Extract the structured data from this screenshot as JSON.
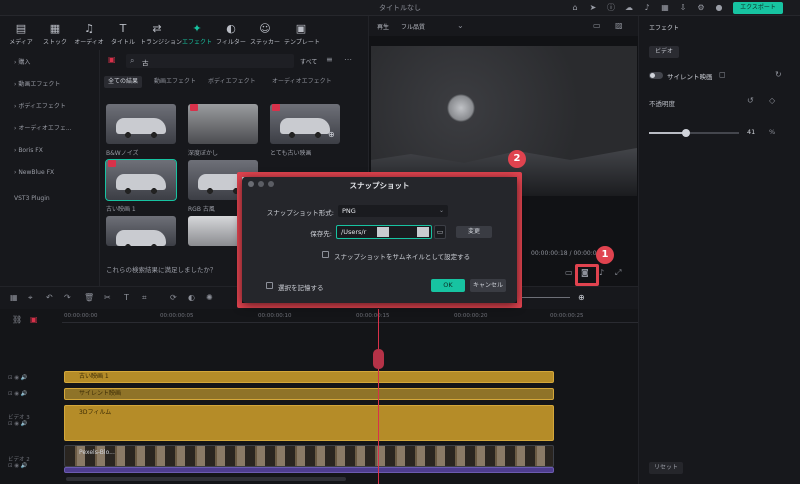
{
  "window": {
    "title": "タイトルなし",
    "export_label": "エクスポート"
  },
  "media_toolbar": {
    "tools": [
      {
        "label": "メディア",
        "icon": "▤"
      },
      {
        "label": "ストック",
        "icon": "▦"
      },
      {
        "label": "オーディオ",
        "icon": "♫"
      },
      {
        "label": "タイトル",
        "icon": "T"
      },
      {
        "label": "トランジション",
        "icon": "⇄"
      },
      {
        "label": "エフェクト",
        "icon": "✦"
      },
      {
        "label": "フィルター",
        "icon": "◐"
      },
      {
        "label": "ステッカー",
        "icon": "☺"
      },
      {
        "label": "テンプレート",
        "icon": "▣"
      }
    ]
  },
  "sidebar": {
    "items": [
      {
        "label": "購入"
      },
      {
        "label": "動画エフェクト"
      },
      {
        "label": "ボディエフェクト"
      },
      {
        "label": "オーディオエフェ..."
      },
      {
        "label": "Boris FX"
      },
      {
        "label": "NewBlue FX"
      }
    ],
    "plugin": "VST3 Plugin"
  },
  "effects": {
    "search_placeholder": "古",
    "view_all": "すべて",
    "filters": [
      "全ての結果",
      "動画エフェクト",
      "ボディエフェクト",
      "オーディオエフェクト"
    ],
    "items": [
      {
        "label": "B&Wノイズ"
      },
      {
        "label": "深度ぼかし"
      },
      {
        "label": "とても古い映画"
      },
      {
        "label": "古い映画 1"
      },
      {
        "label": "RGB 古風"
      },
      {
        "label": ""
      }
    ],
    "feedback": "これらの検索結果に満足しましたか？"
  },
  "preview": {
    "label": "再生",
    "quality": "フル品質",
    "timecode": "00:00:00:18  /  00:00:00:00"
  },
  "right_panel": {
    "tab": "エフェクト",
    "subtab": "ビデオ",
    "effect_name": "サイレント映画",
    "opacity_label": "不透明度",
    "opacity_value": "41",
    "opacity_unit": "%",
    "opacity_fraction": 0.41,
    "reset_label": "リセット"
  },
  "timeline": {
    "ruler": [
      "00:00:00:00",
      "00:00:00:05",
      "00:00:00:10",
      "00:00:00:15",
      "00:00:00:20",
      "00:00:00:25"
    ],
    "tracks": [
      {
        "head": "",
        "clip": "古い映画 1"
      },
      {
        "head": "",
        "clip": "サイレント映画"
      },
      {
        "head": "ビデオ 3",
        "clip": "3Dフィルム"
      },
      {
        "head": "ビデオ 2",
        "clip": "Pexels-Blo..."
      }
    ]
  },
  "dialog": {
    "title": "スナップショット",
    "format_label": "スナップショット形式:",
    "format_value": "PNG",
    "save_label": "保存先:",
    "path_value": "/Users/r",
    "change_label": "変更",
    "thumbnail_label": "スナップショットをサムネイルとして設定する",
    "remember_label": "選択を記憶する",
    "ok_label": "OK",
    "cancel_label": "キャンセル"
  },
  "annotations": {
    "step1": "1",
    "step2": "2"
  },
  "colors": {
    "accent": "#17c3a1",
    "highlight": "#e0434f",
    "clip_gold": "#b58c28"
  }
}
